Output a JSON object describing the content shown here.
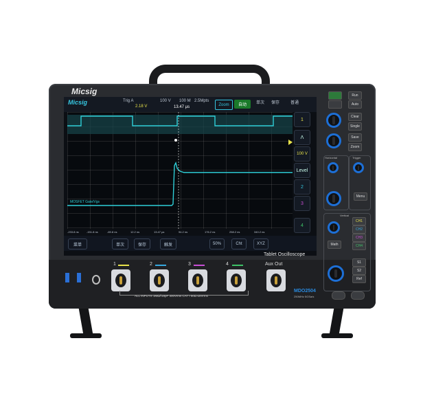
{
  "brand": "Micsig",
  "screen": {
    "logo": "Micsig",
    "sample_label": "Trig A",
    "trigger_level": "2.18 V",
    "timebase": "100 V",
    "points": "100 M",
    "time_label": "13.47 µs",
    "memory": "2.5Mpts",
    "zoom": "Zoom",
    "auto": "自动",
    "single": "单次",
    "save": "保存",
    "normal": "普通",
    "trace_label": "MOSFET Gate/Vgs",
    "bottom_buttons": [
      "菜单",
      "单次",
      "保存",
      "触发",
      "50%",
      "Cht",
      "XYZ"
    ],
    "side_buttons": [
      "1",
      "Λ",
      "100 V",
      "Level",
      "2",
      "3",
      "4"
    ],
    "ticks": [
      "-233.8 ns",
      "-151.8 ns",
      "-69.8 ns",
      "12.2 ns",
      "94.2 ns",
      "176.2 ns",
      "258.2 ns",
      "340.2 ns",
      "-33.8 ns",
      "13.47 µs",
      "58.2 ns"
    ],
    "colors": {
      "ch1": "#e8e34a",
      "ch2": "#36c6e0",
      "trace": "#2fd0d8"
    }
  },
  "front_panel": {
    "channels": [
      "1",
      "2",
      "3",
      "4"
    ],
    "aux": "Aux Out",
    "channel_colors": [
      "#e8e34a",
      "#36a9e0",
      "#c94fd6",
      "#3ec267"
    ],
    "rating": "ALL INPUTS 1MΩ//18pF 300Vrms CAT I   50Ω  ≤5Vrms",
    "product": "Tablet Oscilloscope",
    "model": "MDO2504",
    "specs": "250MHz  5GSa/s"
  },
  "right_panel": {
    "buttons": [
      "Menu",
      "CH1",
      "CH2",
      "CH3",
      "CH4",
      "Math",
      "Ref",
      "S1",
      "S2",
      "Run",
      "Stop",
      "Auto",
      "Clear",
      "Zoom",
      "Single",
      "Save"
    ],
    "sections": [
      "Horizontal",
      "Trigger",
      "Vertical"
    ]
  }
}
